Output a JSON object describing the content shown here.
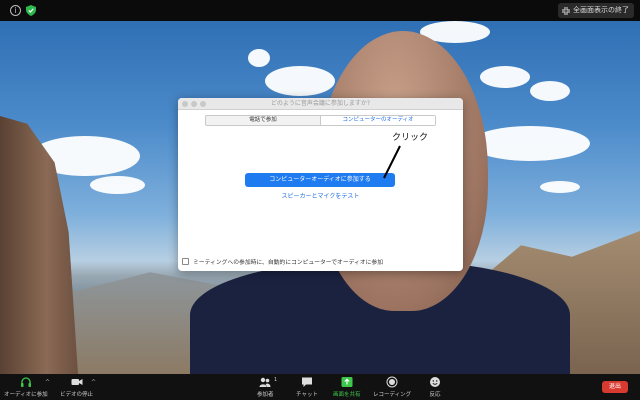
{
  "topbar": {
    "fullscreen_exit_label": "全画面表示の終了"
  },
  "dialog": {
    "title": "どのように音声会議に参加しますか?",
    "tabs": [
      "電話で参加",
      "コンピューターのオーディオ"
    ],
    "join_button": "コンピューターオーディオに参加する",
    "test_link": "スピーカーとマイクをテスト",
    "auto_join_checkbox": "ミーティングへの参加時に、自動的にコンピューターでオーディオに参加"
  },
  "annotation": {
    "text": "クリック"
  },
  "toolbar": {
    "audio": "オーディオに参加",
    "video": "ビデオの停止",
    "participants": "参加者",
    "participants_count": "1",
    "chat": "チャット",
    "share": "画面を共有",
    "record": "レコーディング",
    "reactions": "反応",
    "leave": "退出"
  },
  "colors": {
    "accent": "#1f7bf0",
    "leave": "#d93a30",
    "share_icon": "#3ec84b"
  }
}
